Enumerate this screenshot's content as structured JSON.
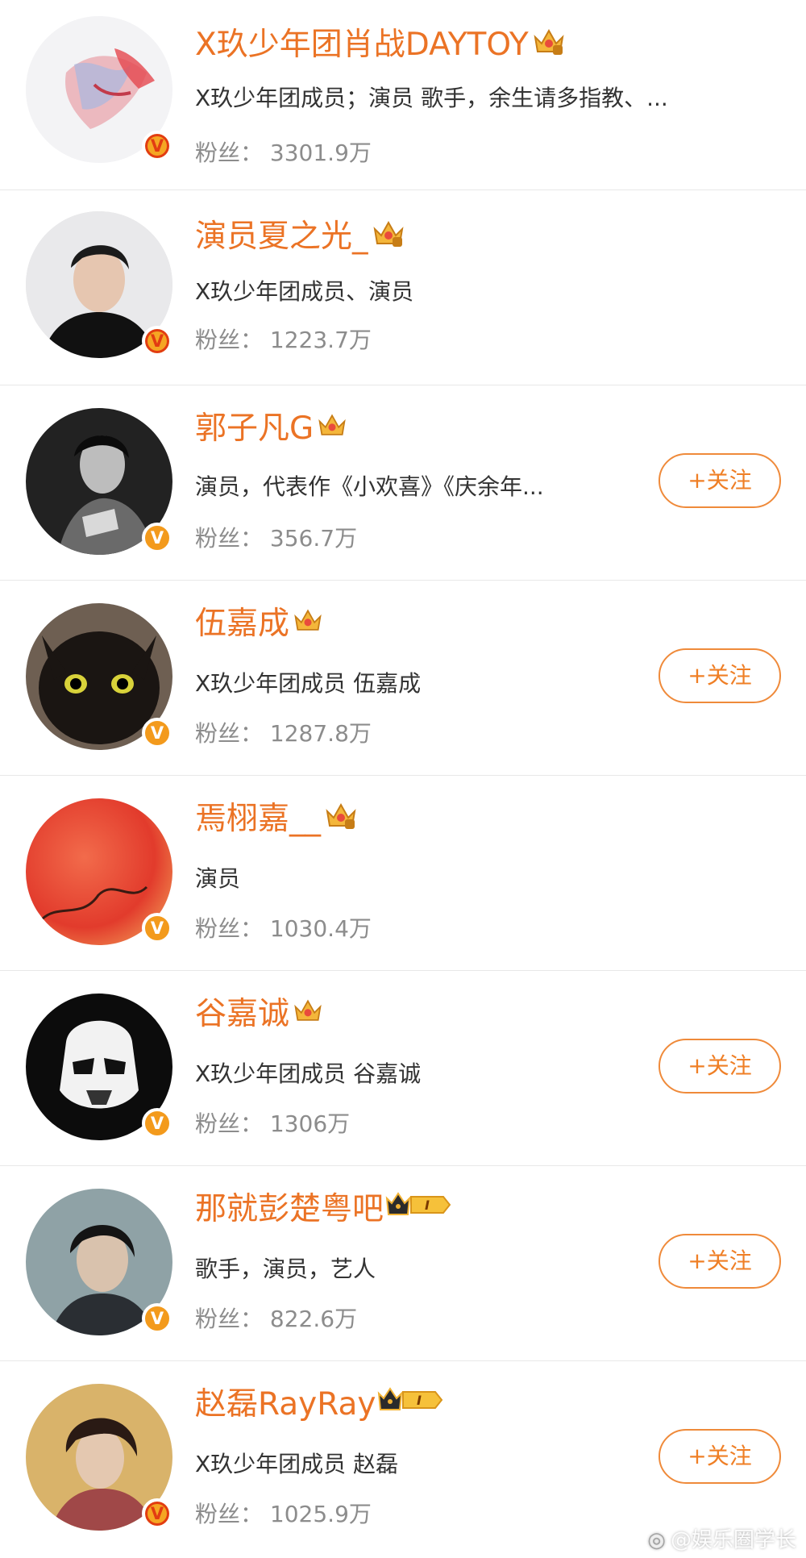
{
  "users": [
    {
      "name": "X玖少年团肖战DAYTOY",
      "desc": "X玖少年团成员；演员 歌手，余生请多指教、...",
      "fans_label": "粉丝：",
      "fans": "3301.9万",
      "follow": "",
      "crown": "crown-icon",
      "badge": "v-gold"
    },
    {
      "name": "演员夏之光_",
      "desc": "X玖少年团成员、演员",
      "fans_label": "粉丝：",
      "fans": "1223.7万",
      "follow": "",
      "crown": "crown-icon",
      "badge": "v-gold"
    },
    {
      "name": "郭子凡G",
      "desc": "演员，代表作《小欢喜》《庆余年...",
      "fans_label": "粉丝：",
      "fans": "356.7万",
      "follow": "+关注",
      "crown": "crown-icon",
      "badge": "v-orange"
    },
    {
      "name": "伍嘉成",
      "desc": "X玖少年团成员 伍嘉成",
      "fans_label": "粉丝：",
      "fans": "1287.8万",
      "follow": "+关注",
      "crown": "crown-icon",
      "badge": "v-orange"
    },
    {
      "name": "焉栩嘉__",
      "desc": "演员",
      "fans_label": "粉丝：",
      "fans": "1030.4万",
      "follow": "",
      "crown": "crown-icon",
      "badge": "v-orange"
    },
    {
      "name": "谷嘉诚",
      "desc": "X玖少年团成员 谷嘉诚",
      "fans_label": "粉丝：",
      "fans": "1306万",
      "follow": "+关注",
      "crown": "crown-icon",
      "badge": "v-orange"
    },
    {
      "name": "那就彭楚粤吧",
      "desc": "歌手，演员，艺人",
      "fans_label": "粉丝：",
      "fans": "822.6万",
      "follow": "+关注",
      "crown": "crown-level-icon",
      "badge": "v-orange"
    },
    {
      "name": "赵磊RayRay",
      "desc": "X玖少年团成员 赵磊",
      "fans_label": "粉丝：",
      "fans": "1025.9万",
      "follow": "+关注",
      "crown": "crown-level-icon",
      "badge": "v-gold"
    }
  ],
  "watermark": "@娱乐圈学长",
  "colors": {
    "accent": "#eb7325",
    "fans_gray": "#8c8c8c",
    "button_border": "#ef8a3a"
  }
}
